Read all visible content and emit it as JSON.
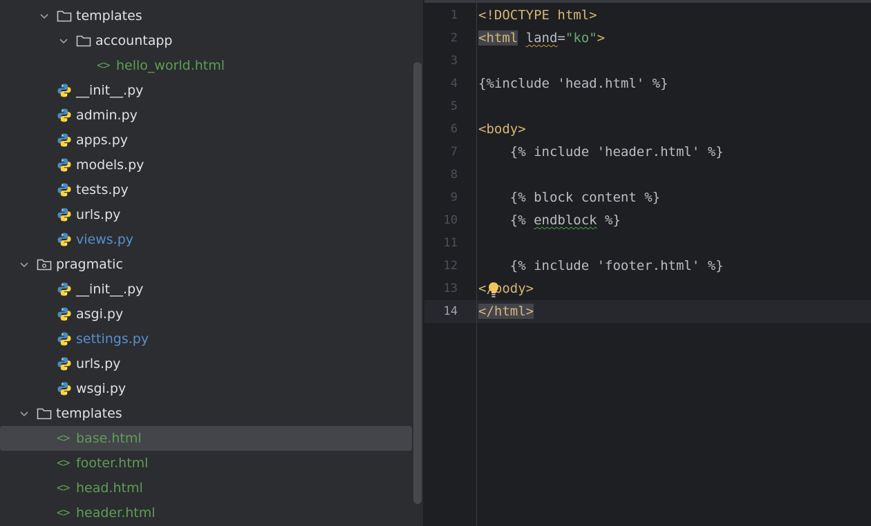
{
  "tree": {
    "rows": [
      {
        "label": "templates",
        "kind": "folder",
        "expanded": true
      },
      {
        "label": "accountapp",
        "kind": "folder",
        "expanded": true
      },
      {
        "label": "hello_world.html",
        "kind": "html"
      },
      {
        "label": "__init__.py",
        "kind": "py"
      },
      {
        "label": "admin.py",
        "kind": "py"
      },
      {
        "label": "apps.py",
        "kind": "py"
      },
      {
        "label": "models.py",
        "kind": "py"
      },
      {
        "label": "tests.py",
        "kind": "py"
      },
      {
        "label": "urls.py",
        "kind": "py"
      },
      {
        "label": "views.py",
        "kind": "py",
        "modified": true
      },
      {
        "label": "pragmatic",
        "kind": "package",
        "expanded": true
      },
      {
        "label": "__init__.py",
        "kind": "py"
      },
      {
        "label": "asgi.py",
        "kind": "py"
      },
      {
        "label": "settings.py",
        "kind": "py",
        "modified": true
      },
      {
        "label": "urls.py",
        "kind": "py"
      },
      {
        "label": "wsgi.py",
        "kind": "py"
      },
      {
        "label": "templates",
        "kind": "folder",
        "expanded": true
      },
      {
        "label": "base.html",
        "kind": "html",
        "selected": true
      },
      {
        "label": "footer.html",
        "kind": "html"
      },
      {
        "label": "head.html",
        "kind": "html"
      },
      {
        "label": "header.html",
        "kind": "html"
      }
    ],
    "html_tag_glyph": "<>"
  },
  "editor": {
    "current_line": 14,
    "line_numbers": [
      "1",
      "2",
      "3",
      "4",
      "5",
      "6",
      "7",
      "8",
      "9",
      "10",
      "11",
      "12",
      "13",
      "14"
    ],
    "lines": {
      "l1": {
        "a": "<!DOCTYPE html>"
      },
      "l2": {
        "a": "<html",
        "b": " ",
        "c": "land",
        "d": "=",
        "e": "\"ko\"",
        "f": ">"
      },
      "l4": {
        "a": "{%include 'head.html' %}"
      },
      "l6": {
        "a": "<body>"
      },
      "l7": {
        "a": "    {% include 'header.html' %}"
      },
      "l9": {
        "a": "    {% block content %}"
      },
      "l10": {
        "a": "    {% ",
        "b": "endblock",
        "c": " %}"
      },
      "l12": {
        "a": "    {% include 'footer.html' %}"
      },
      "l13": {
        "a": "</body>"
      },
      "l14": {
        "a": "</html>"
      }
    }
  },
  "colors": {
    "tree_bg": "#2b2d30",
    "editor_bg": "#1e1f22",
    "tag": "#d5b778",
    "string": "#6aab73",
    "html_file": "#5f9e55",
    "modified_file": "#5a8fcf"
  }
}
